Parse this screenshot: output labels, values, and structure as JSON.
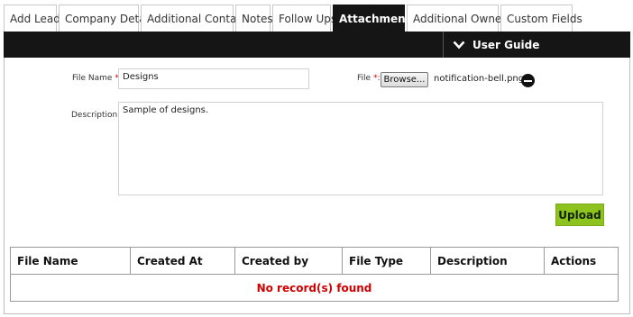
{
  "tabs": [
    {
      "label": "Add Lead",
      "active": false
    },
    {
      "label": "Company Detail",
      "active": false
    },
    {
      "label": "Additional Contact",
      "active": false
    },
    {
      "label": "Notes",
      "active": false
    },
    {
      "label": "Follow Ups",
      "active": false
    },
    {
      "label": "Attachments",
      "active": true
    },
    {
      "label": "Additional Owners",
      "active": false
    },
    {
      "label": "Custom Fields",
      "active": false
    }
  ],
  "header": {
    "user_guide_label": "User Guide",
    "icon": "chevron-down-icon"
  },
  "form": {
    "file_name_label": "File Name",
    "file_name_value": "Designs",
    "file_label": "File",
    "required_marker": "*:",
    "browse_label": "Browse...",
    "selected_file": "notification-bell.png",
    "description_label": "Description:",
    "description_value": "Sample of designs.",
    "upload_label": "Upload"
  },
  "table": {
    "columns": [
      "File Name",
      "Created At",
      "Created by",
      "File Type",
      "Description",
      "Actions"
    ],
    "empty_message": "No record(s) found"
  },
  "colors": {
    "accent": "#8ec31f",
    "bar": "#151515",
    "error": "#d00000"
  }
}
